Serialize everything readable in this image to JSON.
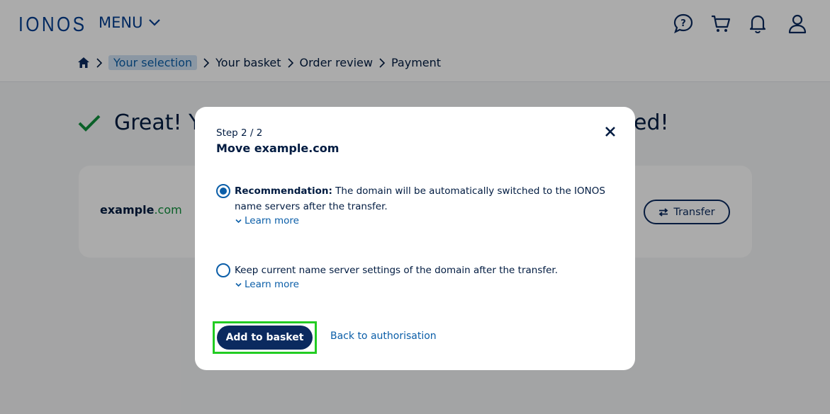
{
  "header": {
    "logo": "IONOS",
    "menu_label": "MENU",
    "icons": [
      "help-chat-icon",
      "cart-icon",
      "bell-icon",
      "user-icon"
    ]
  },
  "breadcrumb": {
    "home_icon": "home-icon",
    "items": [
      "Your selection",
      "Your basket",
      "Order review",
      "Payment"
    ]
  },
  "page": {
    "hero_start": "Great! Y",
    "hero_end": "ed!",
    "domain_name": "example",
    "domain_tld": ".com",
    "transfer_label": "Transfer"
  },
  "modal": {
    "step": "Step 2 / 2",
    "title": "Move example.com",
    "option1_bold": "Recommendation:",
    "option1_line1": " The domain will be automatically switched to the IONOS",
    "option1_line2": "name servers after the transfer.",
    "option2_text": "Keep current name server settings of the domain after the transfer.",
    "learn_more": "Learn more",
    "add_button": "Add to basket",
    "back_link": "Back to authorisation"
  },
  "colors": {
    "brand": "#003d8f",
    "link": "#0b5ea8",
    "primary_button": "#0b2a5f",
    "success": "#0f8f3c",
    "highlight": "#22cc22"
  }
}
